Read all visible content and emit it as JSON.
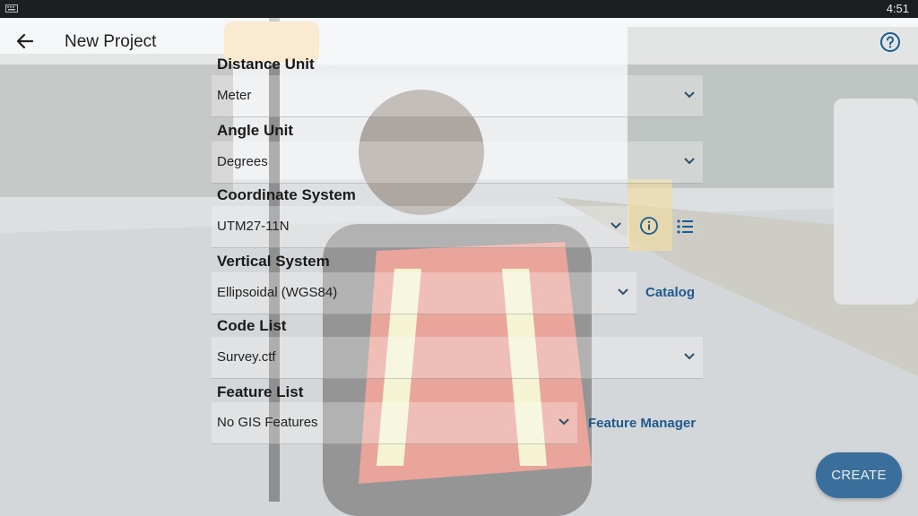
{
  "status_bar": {
    "time": "4:51"
  },
  "app_bar": {
    "title": "New Project",
    "back_icon": "arrow-back-icon",
    "help_icon": "help-circle-icon"
  },
  "form": {
    "distance_unit": {
      "label": "Distance Unit",
      "value": "Meter"
    },
    "angle_unit": {
      "label": "Angle Unit",
      "value": "Degrees"
    },
    "coordinate_system": {
      "label": "Coordinate System",
      "value": "UTM27-11N",
      "info_icon": "info-icon",
      "list_icon": "list-icon"
    },
    "vertical_system": {
      "label": "Vertical System",
      "value": "Ellipsoidal (WGS84)",
      "link": "Catalog"
    },
    "code_list": {
      "label": "Code List",
      "value": "Survey.ctf"
    },
    "feature_list": {
      "label": "Feature List",
      "value": "No GIS Features",
      "link": "Feature Manager"
    }
  },
  "create_button": {
    "label": "CREATE"
  },
  "colors": {
    "accent": "#3a6f9c",
    "link": "#1e5a8c"
  }
}
